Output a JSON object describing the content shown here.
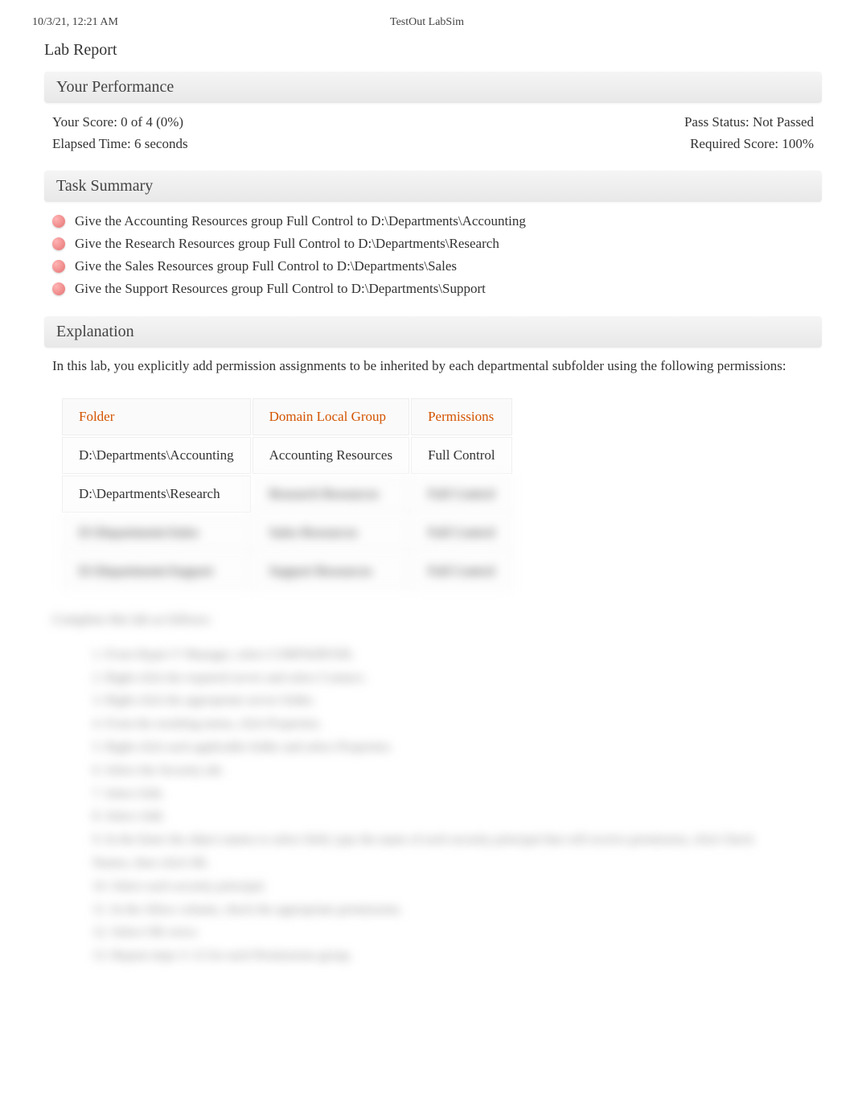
{
  "header": {
    "timestamp": "10/3/21, 12:21 AM",
    "title": "TestOut LabSim"
  },
  "report": {
    "title": "Lab Report"
  },
  "performance": {
    "heading": "Your Performance",
    "score_label": "Your Score: 0 of 4 (0%)",
    "elapsed_label": "Elapsed Time: 6 seconds",
    "pass_label": "Pass Status: Not Passed",
    "required_label": "Required Score: 100%"
  },
  "tasks": {
    "heading": "Task Summary",
    "items": [
      {
        "text": "Give the Accounting Resources group Full Control to D:\\Departments\\Accounting"
      },
      {
        "text": "Give the Research Resources group Full Control to D:\\Departments\\Research"
      },
      {
        "text": "Give the Sales Resources group Full Control to D:\\Departments\\Sales"
      },
      {
        "text": "Give the Support Resources group Full Control to D:\\Departments\\Support"
      }
    ]
  },
  "explanation": {
    "heading": "Explanation",
    "intro": "In this lab, you explicitly add permission assignments to be inherited by each departmental subfolder using the following permissions:",
    "table": {
      "headers": {
        "folder": "Folder",
        "group": "Domain Local Group",
        "perm": "Permissions"
      },
      "rows": [
        {
          "folder": "D:\\Departments\\Accounting",
          "group": "Accounting Resources",
          "perm": "Full Control",
          "blurred": false
        },
        {
          "folder": "D:\\Departments\\Research",
          "group": "Research Resources",
          "perm": "Full Control",
          "blurred_partial": true
        },
        {
          "folder": "D:\\Departments\\Sales",
          "group": "Sales Resources",
          "perm": "Full Control",
          "blurred": true
        },
        {
          "folder": "D:\\Departments\\Support",
          "group": "Support Resources",
          "perm": "Full Control",
          "blurred": true
        }
      ]
    },
    "blurred_para": "Complete this lab as follows:",
    "blurred_steps": "1. From Hyper-V Manager, select CORPSERVER.\n2. Right-click the required server and select Connect.\n3. Right-click the appropriate server folder.\n4. From the resulting menu, click Properties.\n5. Right-click each applicable folder and select Properties.\n6. Select the Security tab.\n7. Select Edit.\n8. Select Add.\n9. In the Enter the object names to select field, type the name of each security principal that will receive permission, click Check Names, then click OK.\n10. Select each security principal.\n11. In the Allow column, check the appropriate permissions.\n12. Select OK twice.\n13. Repeat steps 3–12 for each Permissions group."
  }
}
